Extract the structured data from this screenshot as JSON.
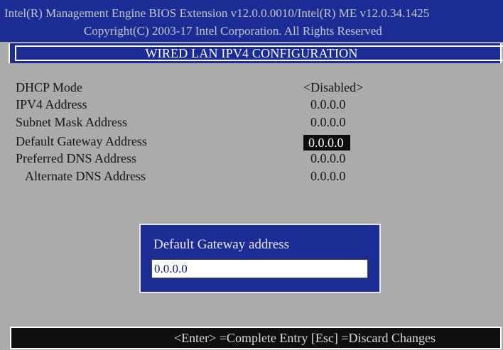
{
  "header": {
    "line1": "Intel(R) Management Engine BIOS Extension v12.0.0.0010/Intel(R) ME v12.0.34.1425",
    "line2": "Copyright(C) 2003-17 Intel Corporation. All Rights Reserved"
  },
  "title": "WIRED LAN IPV4 CONFIGURATION",
  "settings": [
    {
      "label": "DHCP Mode",
      "value": "<Disabled>"
    },
    {
      "label": "IPV4 Address",
      "value": "0.0.0.0"
    },
    {
      "label": "Subnet Mask Address",
      "value": "0.0.0.0"
    },
    {
      "label": "Default Gateway Address",
      "value": "0.0.0.0",
      "selected": true
    },
    {
      "label": "Preferred DNS Address",
      "value": "0.0.0.0"
    },
    {
      "label": "Alternate DNS Address",
      "value": "0.0.0.0"
    }
  ],
  "dialog": {
    "label": "Default Gateway address",
    "input_value": "0.0.0.0"
  },
  "footer": {
    "hint": "<Enter> =Complete Entry  [Esc] =Discard Changes"
  },
  "colors": {
    "background": "#ababab",
    "header_blue": "#1b2d95",
    "highlight": "#0d0d0d"
  }
}
